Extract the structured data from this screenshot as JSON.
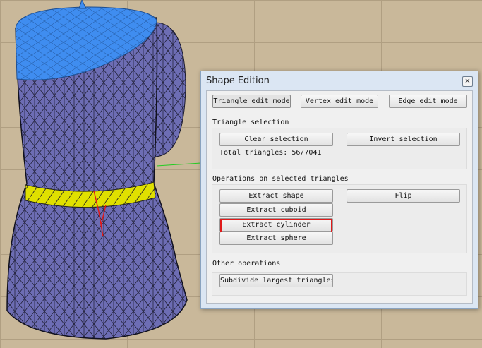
{
  "dialog": {
    "title": "Shape Edition",
    "close_glyph": "✕",
    "modes": [
      "Triangle edit mode",
      "Vertex edit mode",
      "Edge edit mode"
    ],
    "triangle_selection": {
      "heading": "Triangle selection",
      "clear": "Clear selection",
      "invert": "Invert selection",
      "total": "Total triangles: 56/7041"
    },
    "operations": {
      "heading": "Operations on selected triangles",
      "extract_shape": "Extract shape",
      "flip": "Flip",
      "extract_cuboid": "Extract cuboid",
      "extract_cylinder": "Extract cylinder",
      "extract_sphere": "Extract sphere"
    },
    "other": {
      "heading": "Other operations",
      "subdivide": "Subdivide largest triangles"
    }
  },
  "colors": {
    "mesh_body": "#6d6db4",
    "mesh_top": "#3f8df0",
    "ring": "#e0e000",
    "highlight": "#e01a1a"
  }
}
